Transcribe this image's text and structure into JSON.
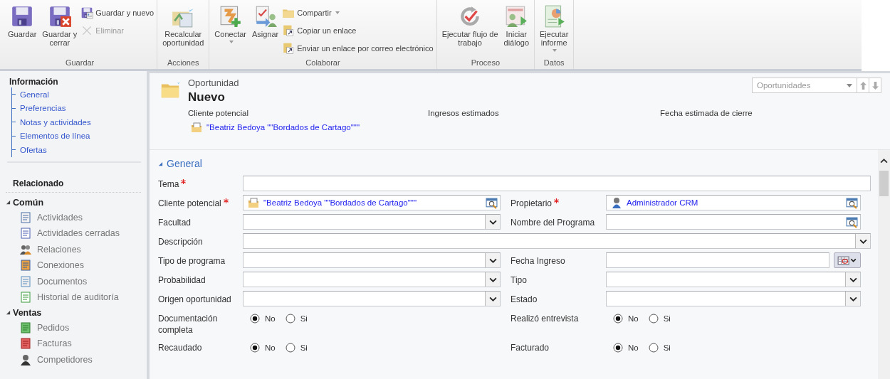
{
  "ribbon": {
    "groups": [
      {
        "label": "Guardar",
        "items": [
          {
            "kind": "large",
            "label": "Guardar",
            "disabled": false,
            "has_menu": false
          },
          {
            "kind": "large",
            "label": "Guardar y\ncerrar",
            "disabled": false,
            "has_menu": false
          },
          {
            "kind": "small",
            "label": "Guardar y nuevo",
            "disabled": false,
            "has_menu": false
          },
          {
            "kind": "small",
            "label": "Eliminar",
            "disabled": true,
            "has_menu": false
          }
        ]
      },
      {
        "label": "Acciones",
        "items": [
          {
            "kind": "large",
            "label": "Recalcular\noportunidad",
            "disabled": false,
            "has_menu": false
          }
        ]
      },
      {
        "label": "Colaborar",
        "items": [
          {
            "kind": "large",
            "label": "Conectar",
            "disabled": false,
            "has_menu": true
          },
          {
            "kind": "large",
            "label": "Asignar",
            "disabled": false,
            "has_menu": false
          },
          {
            "kind": "small",
            "label": "Compartir",
            "disabled": false,
            "has_menu": true
          },
          {
            "kind": "small",
            "label": "Copiar un enlace",
            "disabled": false,
            "has_menu": false
          },
          {
            "kind": "small",
            "label": "Enviar un enlace por correo electrónico",
            "disabled": false,
            "has_menu": false
          }
        ]
      },
      {
        "label": "Proceso",
        "items": [
          {
            "kind": "large",
            "label": "Ejecutar flujo de\ntrabajo",
            "disabled": false,
            "has_menu": false
          },
          {
            "kind": "large",
            "label": "Iniciar\ndiálogo",
            "disabled": false,
            "has_menu": false
          }
        ]
      },
      {
        "label": "Datos",
        "items": [
          {
            "kind": "large",
            "label": "Ejecutar\ninforme",
            "disabled": false,
            "has_menu": true
          }
        ]
      }
    ]
  },
  "sidebar": {
    "info_title": "Información",
    "info_items": [
      "General",
      "Preferencias",
      "Notas y actividades",
      "Elementos de línea",
      "Ofertas"
    ],
    "related_title": "Relacionado",
    "groups": [
      {
        "label": "Común",
        "expanded": true,
        "items": [
          "Actividades",
          "Actividades cerradas",
          "Relaciones",
          "Conexiones",
          "Documentos",
          "Historial de auditoría"
        ]
      },
      {
        "label": "Ventas",
        "expanded": true,
        "items": [
          "Pedidos",
          "Facturas",
          "Competidores"
        ]
      }
    ]
  },
  "header": {
    "entity": "Oportunidad",
    "title": "Nuevo",
    "record_nav": "Oportunidades",
    "summary": [
      {
        "label": "Cliente potencial",
        "value": "\"Beatriz Bedoya \"\"Bordados de Cartago\"\"\""
      },
      {
        "label": "Ingresos estimados"
      },
      {
        "label": "Fecha estimada de cierre"
      }
    ]
  },
  "section": {
    "title": "General",
    "expanded": true,
    "rows": [
      {
        "fields": [
          {
            "kind": "text",
            "label": "Tema",
            "required": true
          }
        ]
      },
      {
        "fields": [
          {
            "kind": "lookup",
            "label": "Cliente potencial",
            "required": true,
            "value": "\"Beatriz Bedoya \"\"Bordados de Cartago\"\"\""
          },
          {
            "kind": "lookup",
            "label": "Propietario",
            "required": true,
            "value": "Administrador CRM"
          }
        ]
      },
      {
        "fields": [
          {
            "kind": "select",
            "label": "Facultad",
            "required": false
          },
          {
            "kind": "lookup",
            "label": "Nombre del Programa",
            "required": false
          }
        ]
      },
      {
        "fields": [
          {
            "kind": "select",
            "label": "Descripción",
            "required": false
          }
        ]
      },
      {
        "fields": [
          {
            "kind": "select",
            "label": "Tipo de programa",
            "required": false
          },
          {
            "kind": "date",
            "label": "Fecha Ingreso",
            "required": false
          }
        ]
      },
      {
        "fields": [
          {
            "kind": "select",
            "label": "Probabilidad",
            "required": false
          },
          {
            "kind": "select",
            "label": "Tipo",
            "required": false
          }
        ]
      },
      {
        "fields": [
          {
            "kind": "select",
            "label": "Origen oportunidad",
            "required": false
          },
          {
            "kind": "select",
            "label": "Estado",
            "required": false
          }
        ]
      },
      {
        "fields": [
          {
            "kind": "radio",
            "label": "Documentación completa",
            "required": false,
            "options": [
              {
                "label": "No",
                "selected": true
              },
              {
                "label": "Si",
                "selected": false
              }
            ]
          },
          {
            "kind": "radio",
            "label": "Realizó entrevista",
            "required": false,
            "options": [
              {
                "label": "No",
                "selected": true
              },
              {
                "label": "Si",
                "selected": false
              }
            ]
          }
        ]
      },
      {
        "fields": [
          {
            "kind": "radio",
            "label": "Recaudado",
            "required": false,
            "options": [
              {
                "label": "No",
                "selected": true
              },
              {
                "label": "Si",
                "selected": false
              }
            ]
          },
          {
            "kind": "radio",
            "label": "Facturado",
            "required": false,
            "options": [
              {
                "label": "No",
                "selected": true
              },
              {
                "label": "Si",
                "selected": false
              }
            ]
          }
        ]
      }
    ]
  }
}
